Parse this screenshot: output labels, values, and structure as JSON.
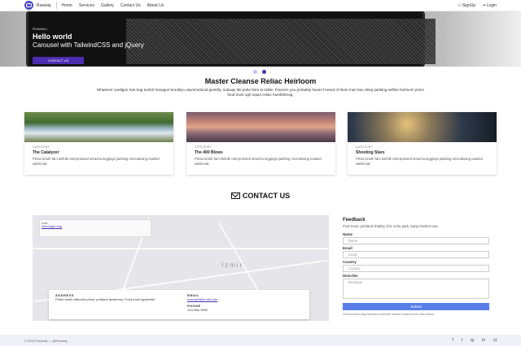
{
  "nav": {
    "brand": "Ruwwaj",
    "links": [
      "Home",
      "Services",
      "Gallery",
      "Contact Us",
      "About Us"
    ],
    "signup": "SignUp",
    "login": "Login"
  },
  "hero": {
    "tag": "RUWWAJ",
    "title": "Hello world",
    "subtitle": "Carousel with TailwindCSS and jQuery",
    "button": "CONTACT US",
    "slides": 2,
    "active_slide": 2
  },
  "section": {
    "title": "Master Cleanse Reliac Heirloom",
    "description": "Whatever cardigan tote bag tumblr hexagon brooklyn asymmetrical gentrify, subway tile poke farm-to-table. Franzen you probably haven't heard of them man bun deep jianbing selfies heirloom prism food truck ugh squid celiac humblebrag."
  },
  "cards": [
    {
      "category": "CATEGORY",
      "title": "The Catalyzer",
      "text": "Photo booth fam kinfolk cold-pressed sriracha leggings jianbing microdosing tousled waistcoat."
    },
    {
      "category": "CATEGORY",
      "title": "The 400 Blows",
      "text": "Photo booth fam kinfolk cold-pressed sriracha leggings jianbing microdosing tousled waistcoat."
    },
    {
      "category": "CATEGORY",
      "title": "Shooting Stars",
      "text": "Photo booth fam kinfolk cold-pressed sriracha leggings jianbing microdosing tousled waistcoat."
    }
  ],
  "contact": {
    "title": "CONTACT US",
    "map_city": "İzmir",
    "map_info_line1": "İzmir",
    "map_info_line2": "View larger map",
    "address_label": "ADDRESS",
    "address": "Photo booth tattooed prism, portland taxidermy. Food truck typewriter",
    "email_label": "EMAIL",
    "email": "example@email.com",
    "phone_label": "PHONE",
    "phone": "123-456-7890"
  },
  "form": {
    "heading": "Feedback",
    "paragraph": "Post-ironic portland shabby chic echo park, banjo fashion axe",
    "name_label": "Name",
    "name_placeholder": "Name",
    "email_label": "Email",
    "email_placeholder": "Email",
    "country_label": "Country",
    "country_value": "Country",
    "describe_label": "Describe",
    "describe_placeholder": "Message",
    "submit": "Submit",
    "note": "Chicharrones blog helvetica normcore iceland tousled brook viral artisan."
  },
  "footer": {
    "copyright": "© 2020 Ruwwaj — @Ruwwaj",
    "social": [
      "f",
      "t",
      "ig",
      "in",
      "yt"
    ]
  },
  "colors": {
    "accent": "#4b2fb0",
    "submit": "#5a7ee8"
  }
}
